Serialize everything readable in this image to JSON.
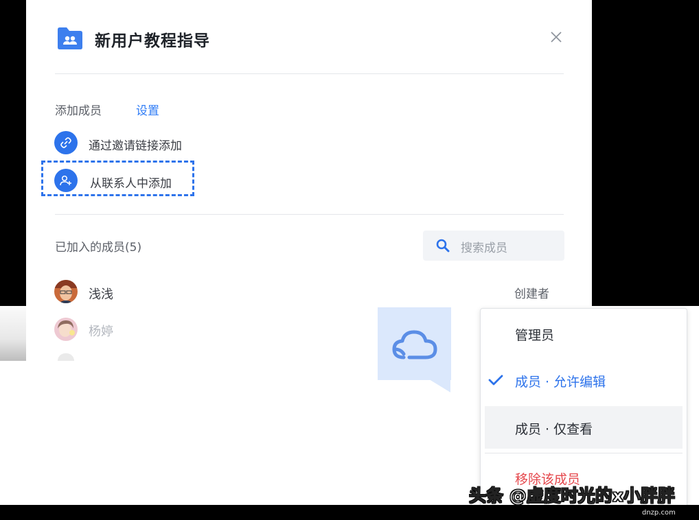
{
  "dialog": {
    "title": "新用户教程指导",
    "add_members_label": "添加成员",
    "settings_link": "设置",
    "invite_link_label": "通过邀请链接添加",
    "add_from_contacts_label": "从联系人中添加",
    "joined_members_label": "已加入的成员(5)",
    "search_placeholder": "搜索成员"
  },
  "members": [
    {
      "name": "浅浅",
      "role": "创建者"
    },
    {
      "name": "杨婷",
      "role": ""
    }
  ],
  "role_menu": {
    "items": [
      {
        "label": "管理员",
        "checked": false,
        "color": "#2b2f36"
      },
      {
        "label": "成员 · 允许编辑",
        "checked": true,
        "color": "#2d73eb"
      },
      {
        "label": "成员 · 仅查看",
        "checked": false,
        "color": "#2b2f36"
      },
      {
        "label": "移除该成员",
        "checked": false,
        "color": "#e5484d"
      }
    ]
  },
  "watermark": {
    "text": "头条 @虚度时光的x小胖胖",
    "site": "dnzp.com"
  },
  "colors": {
    "accent": "#2d73eb",
    "danger": "#e5484d",
    "bubble": "#dbe8fc"
  }
}
